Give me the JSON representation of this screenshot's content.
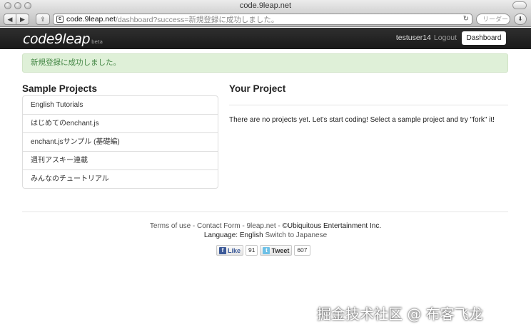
{
  "window": {
    "title": "code.9leap.net"
  },
  "browser": {
    "back_label": "◀",
    "forward_label": "▶",
    "url_host": "code.9leap.net",
    "url_path": "/dashboard?success=新規登録に成功しました。",
    "search_placeholder": "リーダー"
  },
  "navbar": {
    "logo": "code9leap",
    "beta": "beta",
    "username": "testuser14",
    "logout": "Logout",
    "dashboard_button": "Dashboard"
  },
  "alert": {
    "message": "新規登録に成功しました。"
  },
  "sample_projects": {
    "title": "Sample Projects",
    "items": [
      "English Tutorials",
      "はじめてのenchant.js",
      "enchant.jsサンプル (基礎編)",
      "週刊アスキー連載",
      "みんなのチュートリアル"
    ]
  },
  "your_project": {
    "title": "Your Project",
    "empty_message": "There are no projects yet. Let's start coding! Select a sample project and try \"fork\" it!"
  },
  "footer": {
    "terms": "Terms of use",
    "contact": "Contact Form",
    "site": "9leap.net",
    "sep": " - ",
    "copyright": "©Ubiquitous Entertainment Inc.",
    "language_label": "Language: English",
    "switch_language": "Switch to Japanese"
  },
  "social": {
    "like_label": "Like",
    "like_count": "91",
    "tweet_label": "Tweet",
    "tweet_count": "607"
  },
  "watermark": "掘金技术社区 @ 布客飞龙"
}
